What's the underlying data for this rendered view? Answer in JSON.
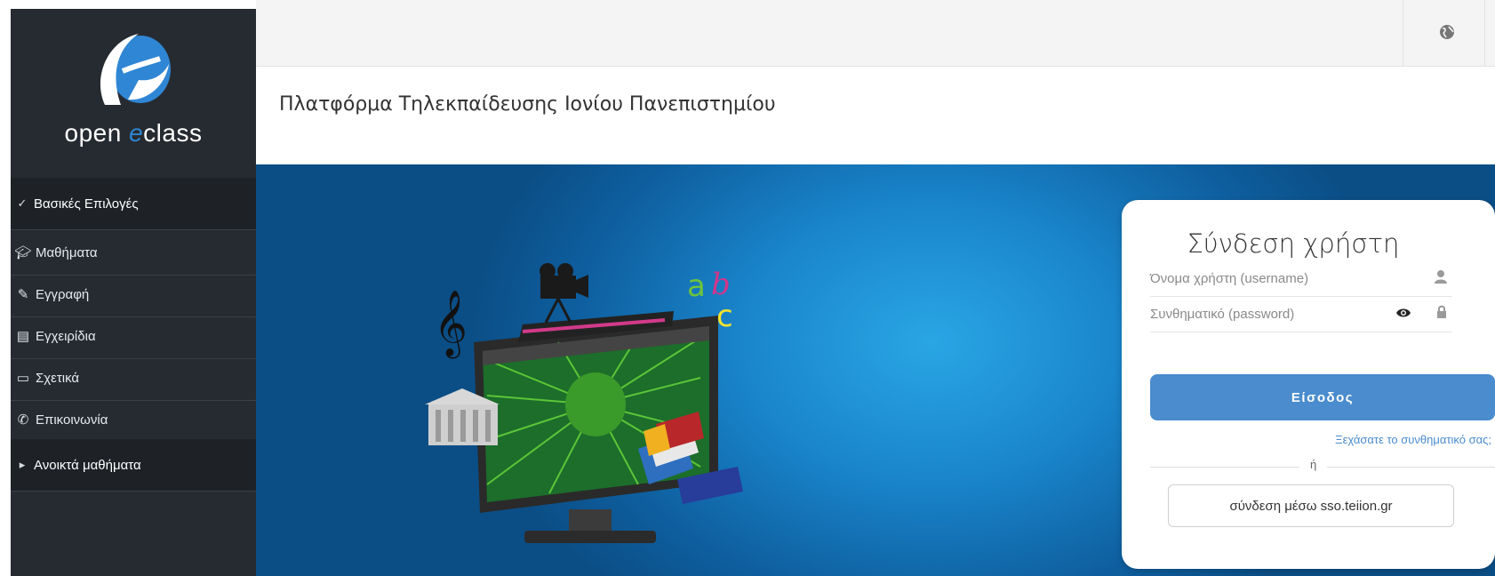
{
  "brand": {
    "logo_text_prefix": "open ",
    "logo_text_e": "e",
    "logo_text_suffix": "class",
    "accent": "#2f86d4"
  },
  "header": {
    "globe_icon": "globe-icon"
  },
  "page_title": "Πλατφόρμα Τηλεκπαίδευσης Ιονίου Πανεπιστημίου",
  "sidebar": {
    "sections": [
      {
        "label": "Βασικές Επιλογές",
        "icon": "check-icon"
      },
      {
        "label": "Ανοικτά μαθήματα",
        "icon": "chevron-right-icon"
      }
    ],
    "items": [
      {
        "label": "Μαθήματα",
        "icon": "graduation-cap-icon"
      },
      {
        "label": "Εγγραφή",
        "icon": "edit-icon"
      },
      {
        "label": "Εγχειρίδια",
        "icon": "document-icon"
      },
      {
        "label": "Σχετικά",
        "icon": "card-icon"
      },
      {
        "label": "Επικοινωνία",
        "icon": "phone-icon"
      }
    ]
  },
  "login": {
    "title": "Σύνδεση χρήστη",
    "username_placeholder": "Όνομα χρήστη (username)",
    "password_placeholder": "Συνθηματικό (password)",
    "submit_label": "Είσοδος",
    "forgot_link": "Ξεχάσατε το συνθηματικό σας;",
    "or_text": "ή",
    "sso_label": "σύνδεση μέσω sso.teiion.gr"
  },
  "colors": {
    "sidebar_bg": "#262b31",
    "button_blue": "#4a8ccd",
    "hero_blue": "#1a86cc"
  }
}
